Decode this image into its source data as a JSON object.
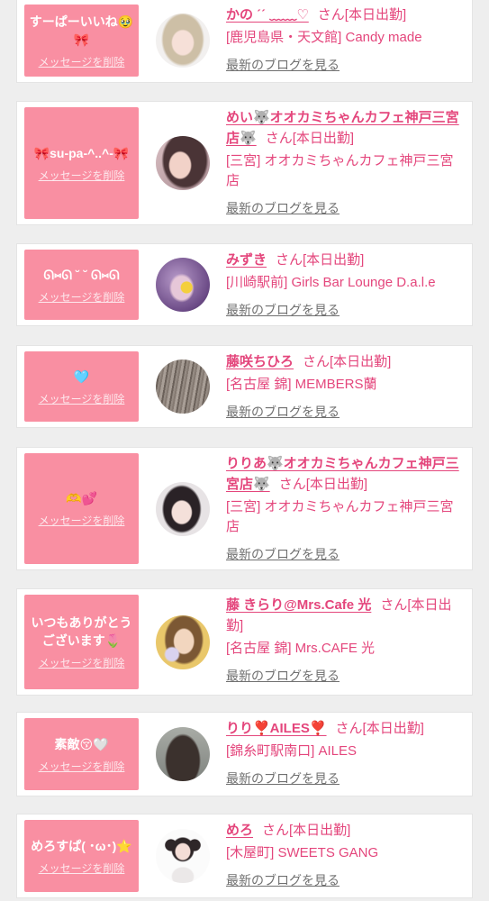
{
  "theme": {
    "page_bg": "#eeeeee",
    "card_bg": "#ffffff",
    "message_box_bg": "#f98fa2",
    "accent_pink": "#e4467c",
    "link_gray": "#707070",
    "delete_link_color": "#fde8ed"
  },
  "actions": {
    "delete_message": "メッセージを削除",
    "view_latest_blog": "最新のブログを見る"
  },
  "cards": [
    {
      "message": "すーぱーいいね🥹🎀",
      "name": "かの ˊˊ ﹏﹏♡",
      "status": "さん[本日出勤]",
      "location": "[鹿児島県・天文館] Candy made"
    },
    {
      "message": "🎀su-pa-^..^-🎀",
      "name": "めい🐺オオカミちゃんカフェ神戸三宮店🐺",
      "status": "さん[本日出勤]",
      "location": "[三宮] オオカミちゃんカフェ神戸三宮店"
    },
    {
      "message": "ᘏ⑅ᘏ ˘ ˘ ᘏ⑅ᘏ",
      "name": "みずき",
      "status": "さん[本日出勤]",
      "location": "[川崎駅前] Girls Bar Lounge D.a.l.e"
    },
    {
      "message": "🩵",
      "name": "藤咲ちひろ",
      "status": "さん[本日出勤]",
      "location": "[名古屋 錦] MEMBERS蘭"
    },
    {
      "message": "🫶💕",
      "name": "りりあ🐺オオカミちゃんカフェ神戸三宮店🐺",
      "status": "さん[本日出勤]",
      "location": "[三宮] オオカミちゃんカフェ神戸三宮店"
    },
    {
      "message": "いつもありがとうございます🌷",
      "name": "藤 きらり@Mrs.Cafe 光",
      "status": "さん[本日出勤]",
      "location": "[名古屋 錦] Mrs.CAFE 光"
    },
    {
      "message": "素敵😚🤍",
      "name": "りり❣️AILES❣️",
      "status": "さん[本日出勤]",
      "location": "[錦糸町駅南口] AILES"
    },
    {
      "message": "めろすぱ( ･ω･)⭐️",
      "name": "めろ",
      "status": "さん[本日出勤]",
      "location": "[木屋町] SWEETS GANG"
    }
  ]
}
